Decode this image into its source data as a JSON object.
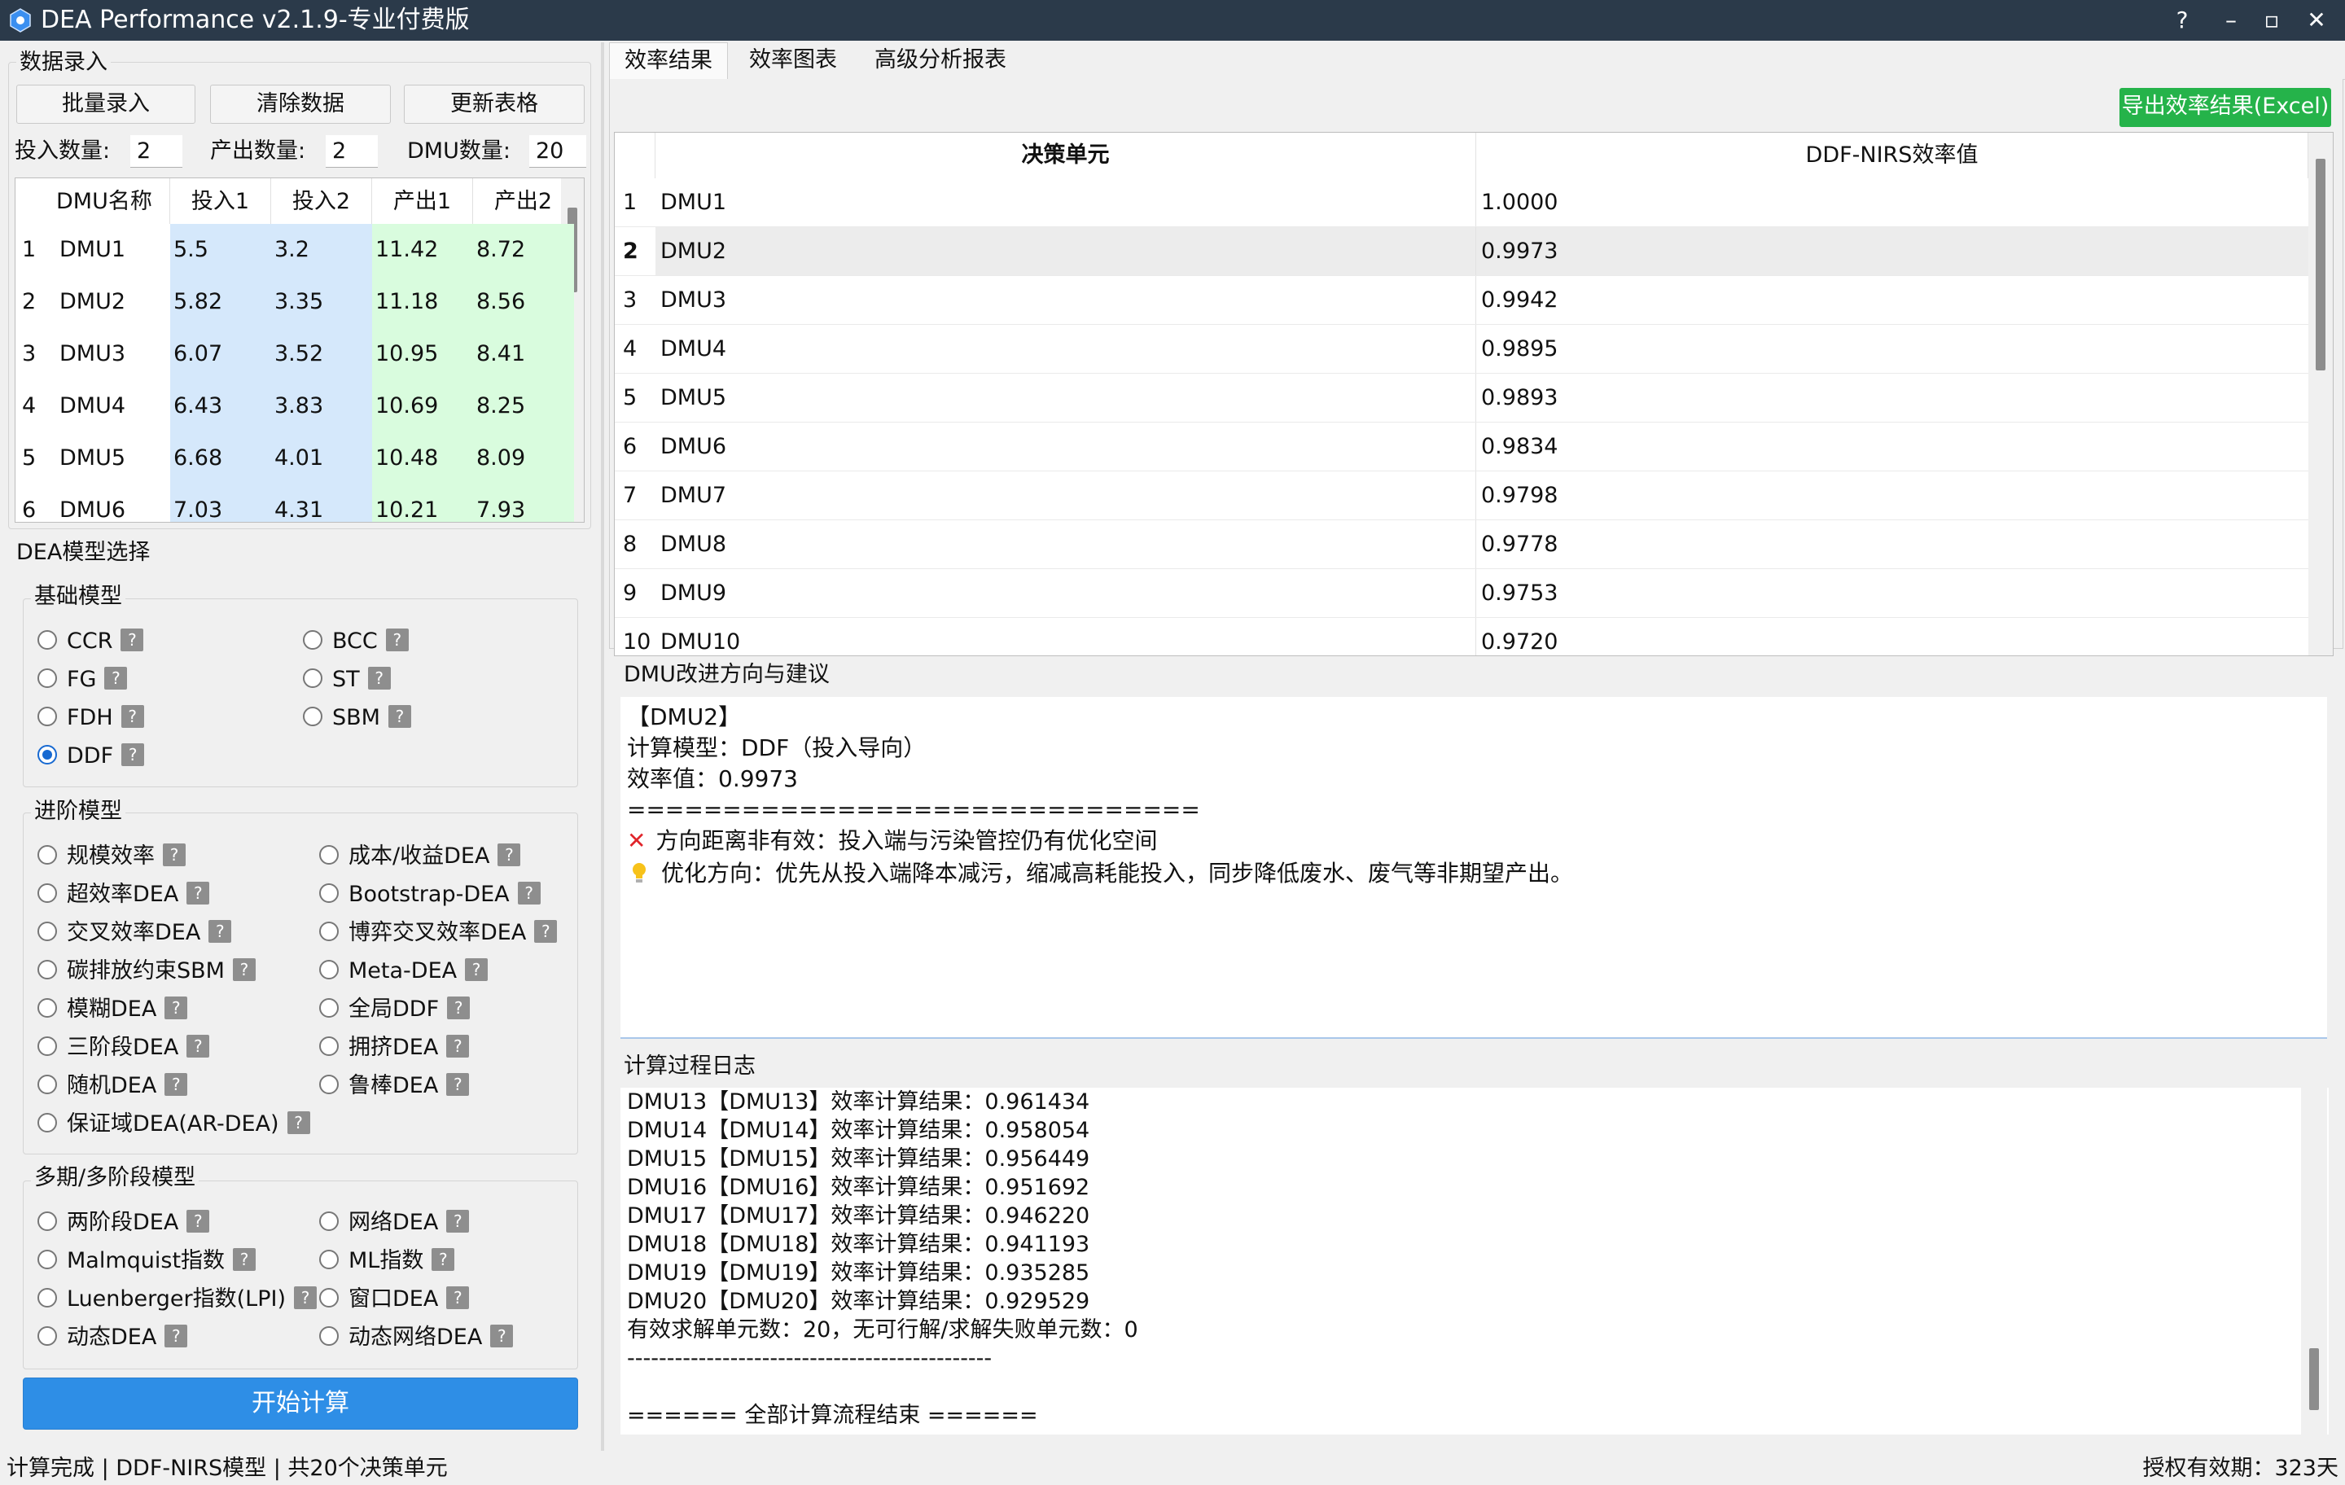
{
  "window": {
    "title": "DEA Performance v2.1.9-专业付费版",
    "help": "?",
    "minimize": "–",
    "maximize": "▫",
    "close": "✕"
  },
  "data_entry": {
    "title": "数据录入",
    "btn_batch": "批量录入",
    "btn_clear": "清除数据",
    "btn_update": "更新表格",
    "input_count_label": "投入数量:",
    "input_count": "2",
    "output_count_label": "产出数量:",
    "output_count": "2",
    "dmu_count_label": "DMU数量:",
    "dmu_count": "20",
    "grid_headers": [
      "DMU名称",
      "投入1",
      "投入2",
      "产出1",
      "产出2"
    ],
    "grid_rows": [
      [
        "1",
        "DMU1",
        "5.5",
        "3.2",
        "11.42",
        "8.72"
      ],
      [
        "2",
        "DMU2",
        "5.82",
        "3.35",
        "11.18",
        "8.56"
      ],
      [
        "3",
        "DMU3",
        "6.07",
        "3.52",
        "10.95",
        "8.41"
      ],
      [
        "4",
        "DMU4",
        "6.43",
        "3.83",
        "10.69",
        "8.25"
      ],
      [
        "5",
        "DMU5",
        "6.68",
        "4.01",
        "10.48",
        "8.09"
      ],
      [
        "6",
        "DMU6",
        "7.03",
        "4.31",
        "10.21",
        "7.93"
      ]
    ]
  },
  "model_select": {
    "title": "DEA模型选择",
    "basic": {
      "title": "基础模型",
      "items": [
        "CCR",
        "BCC",
        "FG",
        "ST",
        "FDH",
        "SBM",
        "DDF"
      ],
      "selected": "DDF"
    },
    "advanced": {
      "title": "进阶模型",
      "items": [
        "规模效率",
        "成本/收益DEA",
        "超效率DEA",
        "Bootstrap-DEA",
        "交叉效率DEA",
        "博弈交叉效率DEA",
        "碳排放约束SBM",
        "Meta-DEA",
        "模糊DEA",
        "全局DDF",
        "三阶段DEA",
        "拥挤DEA",
        "随机DEA",
        "鲁棒DEA",
        "保证域DEA(AR-DEA)"
      ]
    },
    "multi": {
      "title": "多期/多阶段模型",
      "items": [
        "两阶段DEA",
        "网络DEA",
        "Malmquist指数",
        "ML指数",
        "Luenberger指数(LPI)",
        "窗口DEA",
        "动态DEA",
        "动态网络DEA"
      ]
    },
    "help_glyph": "?",
    "start_button": "开始计算"
  },
  "tabs": [
    "效率结果",
    "效率图表",
    "高级分析报表"
  ],
  "results": {
    "export_button": "导出效率结果(Excel)",
    "headers": [
      "决策单元",
      "DDF-NIRS效率值"
    ],
    "rows": [
      [
        "1",
        "DMU1",
        "1.0000"
      ],
      [
        "2",
        "DMU2",
        "0.9973"
      ],
      [
        "3",
        "DMU3",
        "0.9942"
      ],
      [
        "4",
        "DMU4",
        "0.9895"
      ],
      [
        "5",
        "DMU5",
        "0.9893"
      ],
      [
        "6",
        "DMU6",
        "0.9834"
      ],
      [
        "7",
        "DMU7",
        "0.9798"
      ],
      [
        "8",
        "DMU8",
        "0.9778"
      ],
      [
        "9",
        "DMU9",
        "0.9753"
      ],
      [
        "10",
        "DMU10",
        "0.9720"
      ]
    ],
    "selected_row": "2"
  },
  "suggestion": {
    "title": "DMU改进方向与建议",
    "dmu": "【DMU2】",
    "model": "计算模型：DDF（投入导向）",
    "efficiency": "效率值：0.9973",
    "divider": "==============================",
    "status": "方向距离非有效：投入端与污染管控仍有优化空间",
    "advice": "优化方向：优先从投入端降本减污，缩减高耗能投入，同步降低废水、废气等非期望产出。",
    "x_icon": "✕"
  },
  "log": {
    "title": "计算过程日志",
    "lines": [
      "DMU13【DMU13】效率计算结果：0.961434",
      "DMU14【DMU14】效率计算结果：0.958054",
      "DMU15【DMU15】效率计算结果：0.956449",
      "DMU16【DMU16】效率计算结果：0.951692",
      "DMU17【DMU17】效率计算结果：0.946220",
      "DMU18【DMU18】效率计算结果：0.941193",
      "DMU19【DMU19】效率计算结果：0.935285",
      "DMU20【DMU20】效率计算结果：0.929529",
      "有效求解单元数：20，无可行解/求解失败单元数：0",
      "----------------------------------------------",
      "",
      "====== 全部计算流程结束 ======"
    ]
  },
  "status": {
    "left": "计算完成 | DDF-NIRS模型 | 共20个决策单元",
    "right": "授权有效期：323天"
  },
  "colors": {
    "titlebar": "#2b3a4a",
    "input_cols": "#d5e8fb",
    "output_cols": "#d9fcde",
    "primary": "#2e8ee6",
    "export": "#25b34a",
    "radio_selected": "#1769d1"
  }
}
